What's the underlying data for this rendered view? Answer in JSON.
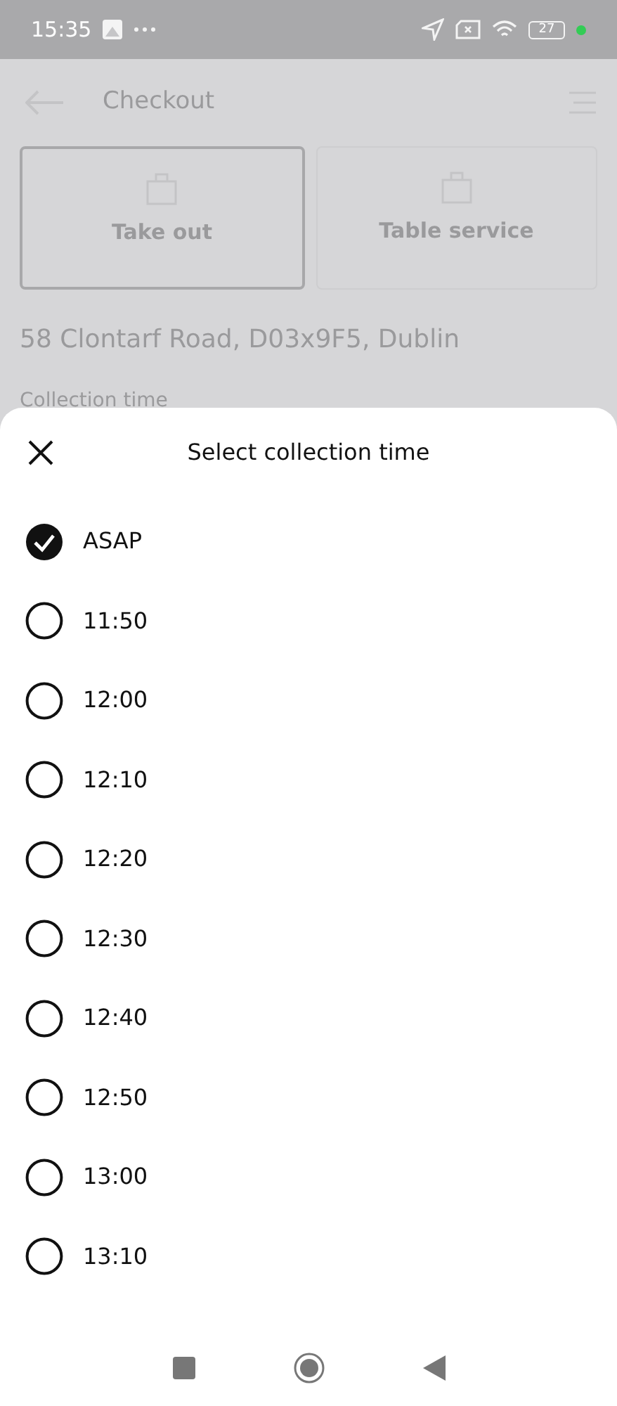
{
  "status_bar": {
    "time": "15:35",
    "battery": "27"
  },
  "background": {
    "title": "Checkout",
    "options": [
      {
        "label": "Take out",
        "selected": true
      },
      {
        "label": "Table service",
        "selected": false
      }
    ],
    "address": "58 Clontarf Road, D03x9F5, Dublin",
    "section": "Collection time"
  },
  "sheet": {
    "title": "Select collection time",
    "options": [
      {
        "label": "ASAP",
        "selected": true
      },
      {
        "label": "11:50",
        "selected": false
      },
      {
        "label": "12:00",
        "selected": false
      },
      {
        "label": "12:10",
        "selected": false
      },
      {
        "label": "12:20",
        "selected": false
      },
      {
        "label": "12:30",
        "selected": false
      },
      {
        "label": "12:40",
        "selected": false
      },
      {
        "label": "12:50",
        "selected": false
      },
      {
        "label": "13:00",
        "selected": false
      },
      {
        "label": "13:10",
        "selected": false
      }
    ]
  }
}
